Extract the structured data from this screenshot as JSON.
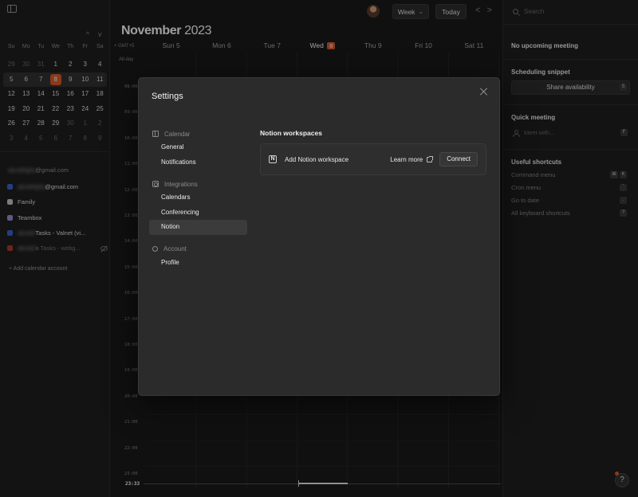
{
  "mini_cal": {
    "weekdays": [
      "Su",
      "Mo",
      "Tu",
      "We",
      "Th",
      "Fr",
      "Sa"
    ],
    "days": [
      "29",
      "30",
      "31",
      "1",
      "2",
      "3",
      "4",
      "5",
      "6",
      "7",
      "8",
      "9",
      "10",
      "11",
      "12",
      "13",
      "14",
      "15",
      "16",
      "17",
      "18",
      "19",
      "20",
      "21",
      "22",
      "23",
      "24",
      "25",
      "26",
      "27",
      "28",
      "29",
      "30",
      "1",
      "2",
      "3",
      "4",
      "5",
      "6",
      "7",
      "8",
      "9"
    ],
    "dim_indices": [
      0,
      1,
      2,
      32,
      33,
      34,
      35,
      36,
      37,
      38,
      39,
      40,
      41
    ],
    "today_index": 10,
    "nav_up": "^",
    "nav_down": "v"
  },
  "calendars": {
    "account_suffix": "@gmail.com",
    "items": [
      {
        "blur": "abcdefghij",
        "label": "@gmail.com",
        "color": "#3b63d6",
        "muted": false
      },
      {
        "blur": "",
        "label": "Family",
        "color": "#c9c9c9",
        "muted": false
      },
      {
        "blur": "",
        "label": "Teambox",
        "color": "#9a8ee0",
        "muted": false
      },
      {
        "blur": "abcdef",
        "label": " Tasks - Valnet (vi...",
        "color": "#3b63d6",
        "muted": false
      },
      {
        "blur": "abcdef",
        "label": "a Tasks - webg...",
        "color": "#b23a2a",
        "muted": true
      }
    ],
    "add_label": "+ Add calendar account"
  },
  "header": {
    "month": "November",
    "year": "2023",
    "view_label": "Week",
    "today_label": "Today",
    "prev": "<",
    "next": ">",
    "tz_label": "+ GMT+5",
    "allday_label": "All-day"
  },
  "days": [
    {
      "name": "Sun",
      "num": "5",
      "current": false
    },
    {
      "name": "Mon",
      "num": "6",
      "current": false
    },
    {
      "name": "Tue",
      "num": "7",
      "current": false
    },
    {
      "name": "Wed",
      "num": "8",
      "current": true
    },
    {
      "name": "Thu",
      "num": "9",
      "current": false
    },
    {
      "name": "Fri",
      "num": "10",
      "current": false
    },
    {
      "name": "Sat",
      "num": "11",
      "current": false
    }
  ],
  "hours": [
    "08:00",
    "09:00",
    "10:00",
    "11:00",
    "12:00",
    "13:00",
    "14:00",
    "15:00",
    "16:00",
    "17:00",
    "18:00",
    "19:00",
    "20:00",
    "21:00",
    "22:00",
    "23:00"
  ],
  "now_time": "23:33",
  "right": {
    "search_placeholder": "Search",
    "no_meeting": "No upcoming meeting",
    "snippet_title": "Scheduling snippet",
    "share_label": "Share availability",
    "share_key": "S",
    "quick_title": "Quick meeting",
    "meet_placeholder": "Meet with...",
    "meet_key": "F",
    "shortcuts_title": "Useful shortcuts",
    "shortcuts": [
      {
        "label": "Command menu",
        "keys": [
          "⌘",
          "K"
        ]
      },
      {
        "label": "Cron menu",
        "keys": [
          "`"
        ]
      },
      {
        "label": "Go to date",
        "keys": [
          "."
        ]
      },
      {
        "label": "All keyboard shortcuts",
        "keys": [
          "?"
        ]
      }
    ],
    "help": "?"
  },
  "modal": {
    "title": "Settings",
    "nav": [
      {
        "group": "Calendar",
        "icon": "calendar-icon",
        "items": [
          "General",
          "Notifications"
        ]
      },
      {
        "group": "Integrations",
        "icon": "integrations-icon",
        "items": [
          "Calendars",
          "Conferencing",
          "Notion"
        ]
      },
      {
        "group": "Account",
        "icon": "account-icon",
        "items": [
          "Profile"
        ]
      }
    ],
    "active_item": "Notion",
    "section_title": "Notion workspaces",
    "logo_glyph": "N",
    "add_workspace": "Add Notion workspace",
    "learn_more": "Learn more",
    "connect": "Connect"
  }
}
